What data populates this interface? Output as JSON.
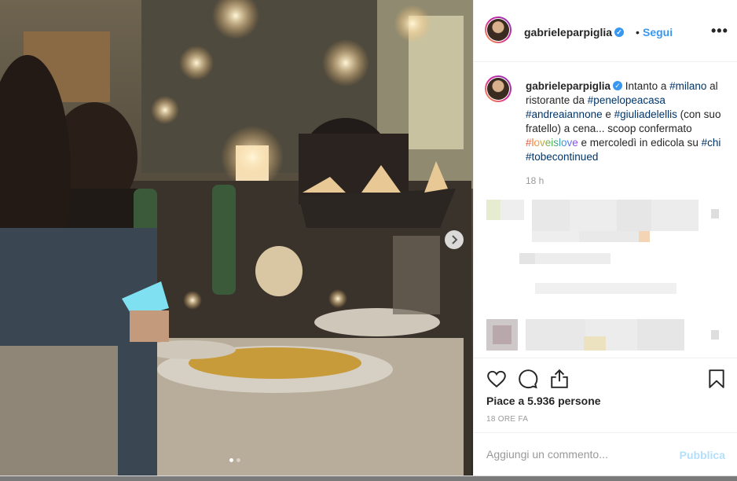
{
  "post": {
    "image_alt": "",
    "carousel_dots": 2,
    "active_dot": 1
  },
  "header": {
    "username": "gabrieleparpiglia",
    "separator": "•",
    "follow_label": "Segui",
    "more_label": "•••"
  },
  "caption": {
    "username": "gabrieleparpiglia",
    "t1": " Intanto a ",
    "tag_milano": "#milano",
    "t2": " al ristorante da ",
    "tag_penelope": "#penelopeacasa",
    "t3": " ",
    "tag_andrea": "#andreaiannone",
    "t4": " e ",
    "tag_giulia": "#giuliadelellis",
    "t5": " (con suo fratello) a cena... scoop confermato ",
    "tag_loveislove": "#loveislove",
    "t6": " e mercoledì in edicola su ",
    "tag_chi": "#chi",
    "t7": " ",
    "tag_tobecontinued": "#tobecontinued",
    "time": "18 h"
  },
  "actions": {
    "likes": "Piace a 5.936 persone",
    "time_ago": "18 ORE FA"
  },
  "comment": {
    "placeholder": "Aggiungi un commento...",
    "publish_label": "Pubblica"
  },
  "icons": {
    "like": "heart-icon",
    "comment": "comment-icon",
    "share": "share-icon",
    "save": "bookmark-icon",
    "next": "chevron-right-icon",
    "verified": "verified-badge-icon"
  },
  "colors": {
    "accent": "#3897f0",
    "hashtag": "#003569",
    "muted": "#999999",
    "publish_disabled": "#b2dffc"
  }
}
